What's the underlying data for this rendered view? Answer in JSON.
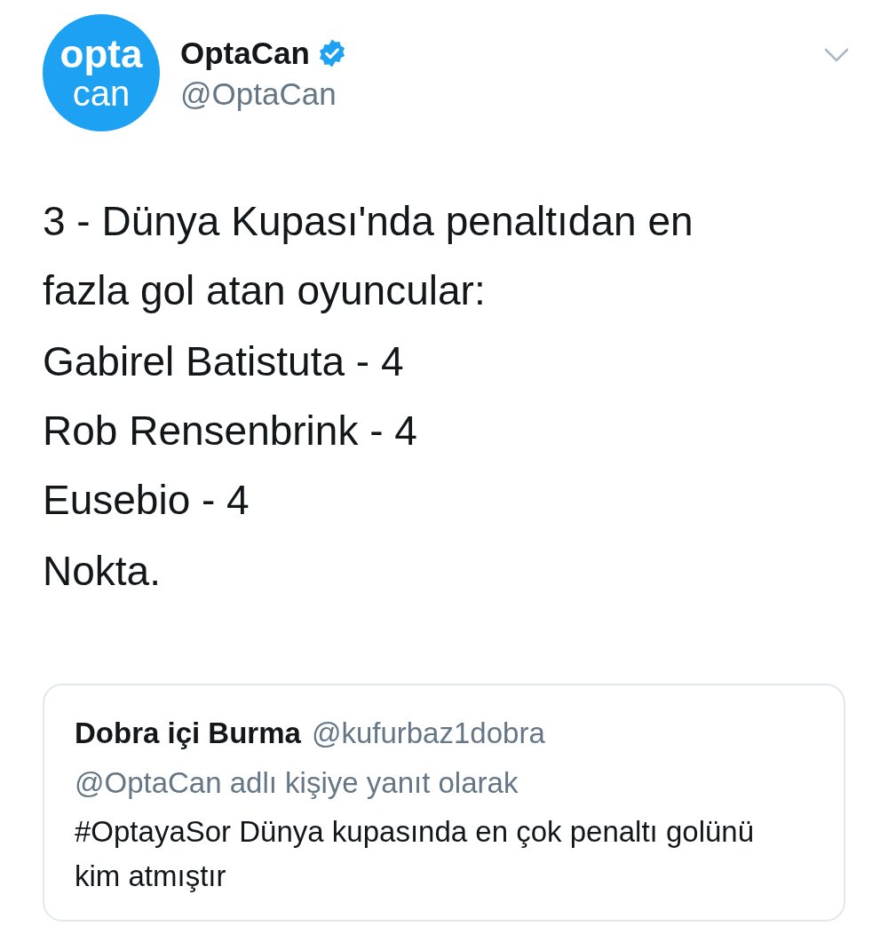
{
  "author": {
    "avatar_top": "opta",
    "avatar_bottom": "can",
    "name": "OptaCan",
    "verified": true,
    "handle": "@OptaCan"
  },
  "tweet": {
    "paragraphs": [
      {
        "kind": "text",
        "lines": [
          "3 - Dünya Kupası'nda penaltıdan en fazla gol atan oyuncular:"
        ]
      },
      {
        "kind": "list",
        "lines": [
          "Gabirel Batistuta - 4",
          "Rob Rensenbrink - 4",
          "Eusebio - 4"
        ]
      },
      {
        "kind": "text",
        "lines": [
          "Nokta."
        ]
      }
    ]
  },
  "quoted": {
    "name": "Dobra içi Burma",
    "handle": "@kufurbaz1dobra",
    "reply_to": "@OptaCan adlı kişiye yanıt olarak",
    "text": "#OptayaSor Dünya kupasında en çok penaltı golünü kim atmıştır"
  }
}
